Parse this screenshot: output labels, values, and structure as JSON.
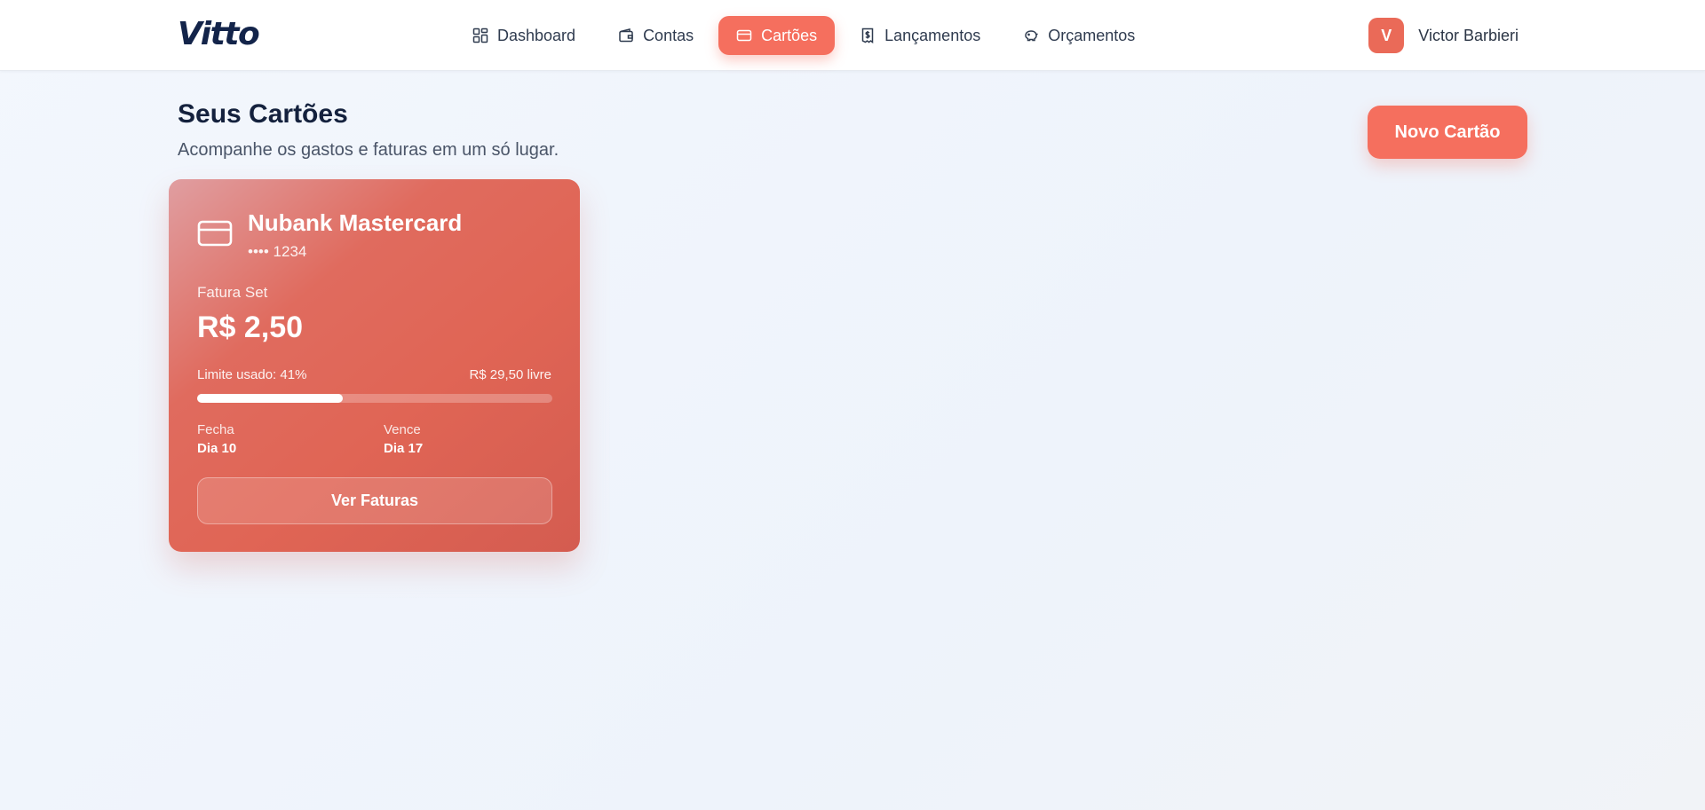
{
  "app": {
    "logo": "Vitto"
  },
  "nav": {
    "items": [
      {
        "label": "Dashboard",
        "icon": "dashboard-grid-icon",
        "active": false
      },
      {
        "label": "Contas",
        "icon": "wallet-icon",
        "active": false
      },
      {
        "label": "Cartões",
        "icon": "credit-card-icon",
        "active": true
      },
      {
        "label": "Lançamentos",
        "icon": "receipt-icon",
        "active": false
      },
      {
        "label": "Orçamentos",
        "icon": "piggy-bank-icon",
        "active": false
      }
    ]
  },
  "user": {
    "initial": "V",
    "name": "Victor Barbieri"
  },
  "page": {
    "title": "Seus Cartões",
    "subtitle": "Acompanhe os gastos e faturas em um só lugar.",
    "new_card_label": "Novo Cartão"
  },
  "cards": [
    {
      "name": "Nubank Mastercard",
      "number": "•••• 1234",
      "icon": "credit-card-icon",
      "invoice_label": "Fatura Set",
      "invoice_amount": "R$ 2,50",
      "limit_used_label": "Limite usado: 41%",
      "limit_used_fraction": 0.41,
      "limit_free_label": "R$ 29,50 livre",
      "close_label": "Fecha",
      "close_value": "Dia 10",
      "due_label": "Vence",
      "due_value": "Dia 17",
      "invoices_button_label": "Ver Faturas"
    }
  ],
  "colors": {
    "accent": "#f56f5e",
    "brand_dark": "#13244a",
    "card_gradient_start": "#e09ea1",
    "card_gradient_end": "#d45c50"
  }
}
